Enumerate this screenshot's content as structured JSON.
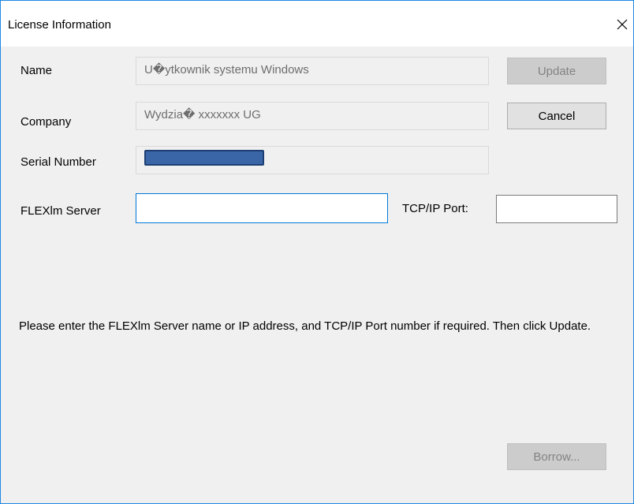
{
  "window": {
    "title": "License Information",
    "close_glyph": "✕"
  },
  "form": {
    "name_label": "Name",
    "name_value": "U�ytkownik systemu Windows",
    "company_label": "Company",
    "company_value": "Wydzia� xxxxxxx UG",
    "serial_label": "Serial Number",
    "serial_value": "",
    "flexlm_label": "FLEXlm Server",
    "flexlm_value": "",
    "port_label": "TCP/IP Port:",
    "port_value": ""
  },
  "buttons": {
    "update": "Update",
    "cancel": "Cancel",
    "borrow": "Borrow..."
  },
  "message": "Please enter the FLEXlm Server name or IP address, and TCP/IP Port number if required. Then click Update.",
  "icons": {
    "close": "close-icon",
    "redaction": "redaction-bar"
  },
  "colors": {
    "window_border": "#1f88e5",
    "input_focus_border": "#0078d7",
    "redaction_fill": "#3a66a8"
  }
}
